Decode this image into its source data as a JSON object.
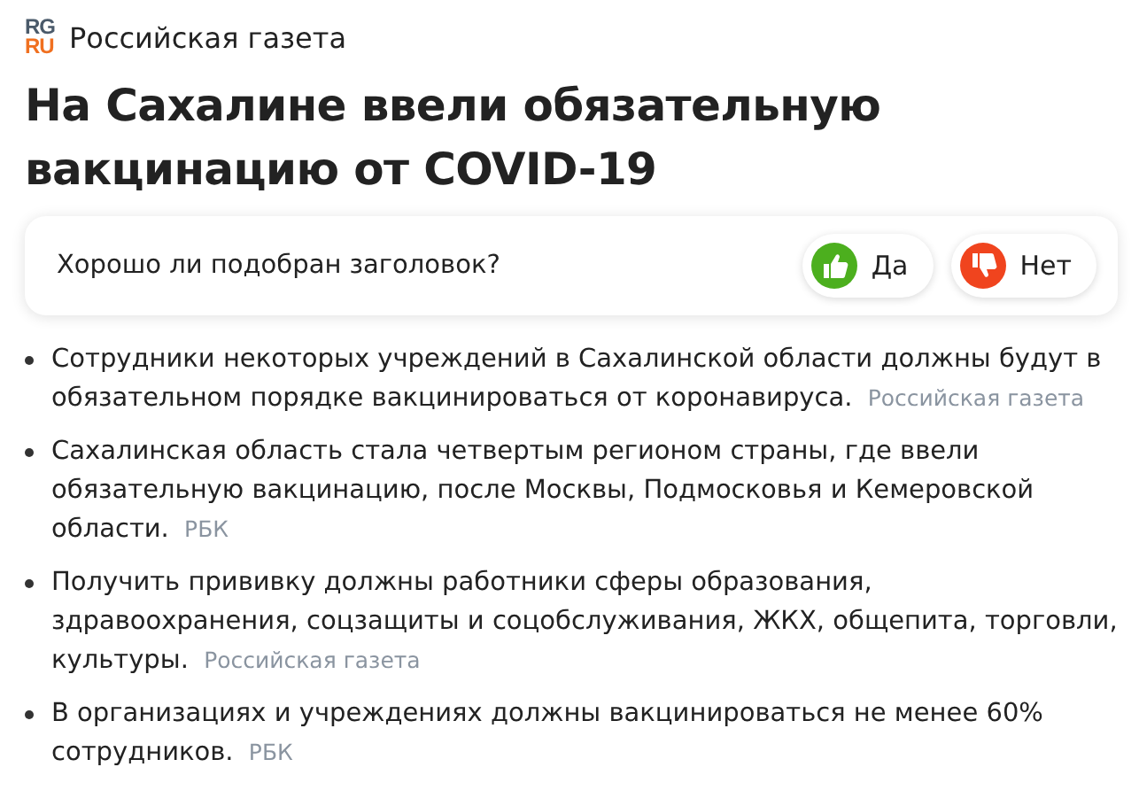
{
  "source": {
    "logo_top": "RG",
    "logo_bottom": "RU",
    "name": "Российская газета"
  },
  "title": "На Сахалине ввели обязательную вакцинацию от COVID-19",
  "feedback": {
    "question": "Хорошо ли подобран заголовок?",
    "buttons": [
      {
        "kind": "like",
        "label": "Да"
      },
      {
        "kind": "dislike",
        "label": "Нет"
      }
    ]
  },
  "items": [
    {
      "text": "Сотрудники некоторых учреждений в Сахалинской области должны будут в обязательном порядке вакцинироваться от коронавируса.",
      "source": "Российская газета"
    },
    {
      "text": "Сахалинская область стала четвертым регионом страны, где ввели обязательную вакцинацию, после Москвы, Подмосковья и Кемеровской области.",
      "source": "РБК"
    },
    {
      "text": "Получить прививку должны работники сферы образования, здравоохранения, соцзащиты и соцобслуживания, ЖКХ, общепита, торговли, культуры.",
      "source": "Российская газета"
    },
    {
      "text": "В организациях и учреждениях должны вакцинироваться не менее 60% сотрудников.",
      "source": "РБК"
    }
  ]
}
